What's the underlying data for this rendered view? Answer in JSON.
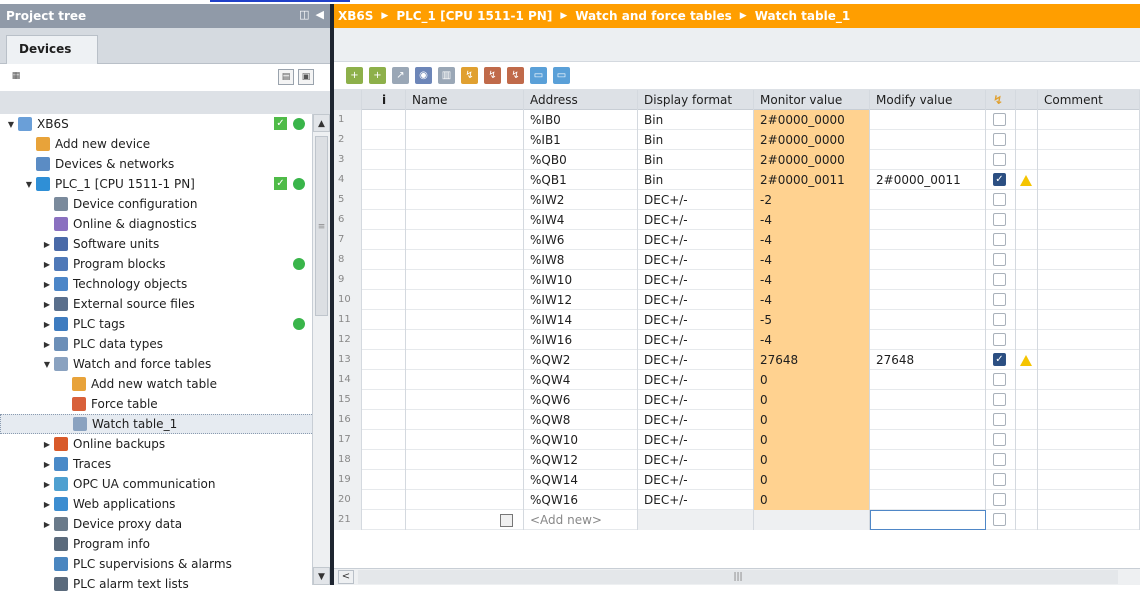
{
  "project_tree": {
    "title": "Project tree",
    "devices_tab": "Devices",
    "items": [
      {
        "label": "XB6S",
        "level": 0,
        "arrow": "▼",
        "icon": "#6a9fd8",
        "status_box": true,
        "status_dot": true
      },
      {
        "label": "Add new device",
        "level": 1,
        "arrow": "",
        "icon": "#e8a33a"
      },
      {
        "label": "Devices & networks",
        "level": 1,
        "arrow": "",
        "icon": "#5b8cc4"
      },
      {
        "label": "PLC_1 [CPU 1511-1 PN]",
        "level": 1,
        "arrow": "▼",
        "icon": "#2f8fd6",
        "status_box": true,
        "status_dot": true
      },
      {
        "label": "Device configuration",
        "level": 2,
        "arrow": "",
        "icon": "#7a8a9c"
      },
      {
        "label": "Online & diagnostics",
        "level": 2,
        "arrow": "",
        "icon": "#8a70c0"
      },
      {
        "label": "Software units",
        "level": 2,
        "arrow": "▶",
        "icon": "#4a6aa8"
      },
      {
        "label": "Program blocks",
        "level": 2,
        "arrow": "▶",
        "icon": "#4f79b8",
        "status_dot": true
      },
      {
        "label": "Technology objects",
        "level": 2,
        "arrow": "▶",
        "icon": "#4c86c8"
      },
      {
        "label": "External source files",
        "level": 2,
        "arrow": "▶",
        "icon": "#5a6f8c"
      },
      {
        "label": "PLC tags",
        "level": 2,
        "arrow": "▶",
        "icon": "#3e7cc0",
        "status_dot": true
      },
      {
        "label": "PLC data types",
        "level": 2,
        "arrow": "▶",
        "icon": "#6c8fb8"
      },
      {
        "label": "Watch and force tables",
        "level": 2,
        "arrow": "▼",
        "icon": "#8aa2c0"
      },
      {
        "label": "Add new watch table",
        "level": 3,
        "arrow": "",
        "icon": "#e8a33a"
      },
      {
        "label": "Force table",
        "level": 3,
        "arrow": "",
        "icon": "#d8603a"
      },
      {
        "label": "Watch table_1",
        "level": 3,
        "arrow": "",
        "icon": "#8aa2c0",
        "selected": true
      },
      {
        "label": "Online backups",
        "level": 2,
        "arrow": "▶",
        "icon": "#d85a2a"
      },
      {
        "label": "Traces",
        "level": 2,
        "arrow": "▶",
        "icon": "#4a8ac8"
      },
      {
        "label": "OPC UA communication",
        "level": 2,
        "arrow": "▶",
        "icon": "#4fa0d0"
      },
      {
        "label": "Web applications",
        "level": 2,
        "arrow": "▶",
        "icon": "#3c8dd0"
      },
      {
        "label": "Device proxy data",
        "level": 2,
        "arrow": "▶",
        "icon": "#6a7a8a"
      },
      {
        "label": "Program info",
        "level": 2,
        "arrow": "",
        "icon": "#5a6a7c"
      },
      {
        "label": "PLC supervisions & alarms",
        "level": 2,
        "arrow": "",
        "icon": "#4a86c0"
      },
      {
        "label": "PLC alarm text lists",
        "level": 2,
        "arrow": "",
        "icon": "#5a6a7c"
      }
    ]
  },
  "breadcrumb": [
    "XB6S",
    "PLC_1 [CPU 1511-1 PN]",
    "Watch and force tables",
    "Watch table_1"
  ],
  "table": {
    "headers": {
      "i": "i",
      "name": "Name",
      "address": "Address",
      "format": "Display format",
      "monitor": "Monitor value",
      "modify": "Modify value",
      "comment": "Comment"
    },
    "rows": [
      {
        "num": "1",
        "address": "%IB0",
        "format": "Bin",
        "monitor": "2#0000_0000",
        "modify": "",
        "checked": false,
        "warn": false
      },
      {
        "num": "2",
        "address": "%IB1",
        "format": "Bin",
        "monitor": "2#0000_0000",
        "modify": "",
        "checked": false,
        "warn": false
      },
      {
        "num": "3",
        "address": "%QB0",
        "format": "Bin",
        "monitor": "2#0000_0000",
        "modify": "",
        "checked": false,
        "warn": false
      },
      {
        "num": "4",
        "address": "%QB1",
        "format": "Bin",
        "monitor": "2#0000_0011",
        "modify": "2#0000_0011",
        "checked": true,
        "warn": true
      },
      {
        "num": "5",
        "address": "%IW2",
        "format": "DEC+/-",
        "monitor": "-2",
        "modify": "",
        "checked": false,
        "warn": false
      },
      {
        "num": "6",
        "address": "%IW4",
        "format": "DEC+/-",
        "monitor": "-4",
        "modify": "",
        "checked": false,
        "warn": false
      },
      {
        "num": "7",
        "address": "%IW6",
        "format": "DEC+/-",
        "monitor": "-4",
        "modify": "",
        "checked": false,
        "warn": false
      },
      {
        "num": "8",
        "address": "%IW8",
        "format": "DEC+/-",
        "monitor": "-4",
        "modify": "",
        "checked": false,
        "warn": false
      },
      {
        "num": "9",
        "address": "%IW10",
        "format": "DEC+/-",
        "monitor": "-4",
        "modify": "",
        "checked": false,
        "warn": false
      },
      {
        "num": "10",
        "address": "%IW12",
        "format": "DEC+/-",
        "monitor": "-4",
        "modify": "",
        "checked": false,
        "warn": false
      },
      {
        "num": "11",
        "address": "%IW14",
        "format": "DEC+/-",
        "monitor": "-5",
        "modify": "",
        "checked": false,
        "warn": false
      },
      {
        "num": "12",
        "address": "%IW16",
        "format": "DEC+/-",
        "monitor": "-4",
        "modify": "",
        "checked": false,
        "warn": false
      },
      {
        "num": "13",
        "address": "%QW2",
        "format": "DEC+/-",
        "monitor": "27648",
        "modify": "27648",
        "checked": true,
        "warn": true
      },
      {
        "num": "14",
        "address": "%QW4",
        "format": "DEC+/-",
        "monitor": "0",
        "modify": "",
        "checked": false,
        "warn": false
      },
      {
        "num": "15",
        "address": "%QW6",
        "format": "DEC+/-",
        "monitor": "0",
        "modify": "",
        "checked": false,
        "warn": false
      },
      {
        "num": "16",
        "address": "%QW8",
        "format": "DEC+/-",
        "monitor": "0",
        "modify": "",
        "checked": false,
        "warn": false
      },
      {
        "num": "17",
        "address": "%QW10",
        "format": "DEC+/-",
        "monitor": "0",
        "modify": "",
        "checked": false,
        "warn": false
      },
      {
        "num": "18",
        "address": "%QW12",
        "format": "DEC+/-",
        "monitor": "0",
        "modify": "",
        "checked": false,
        "warn": false
      },
      {
        "num": "19",
        "address": "%QW14",
        "format": "DEC+/-",
        "monitor": "0",
        "modify": "",
        "checked": false,
        "warn": false
      },
      {
        "num": "20",
        "address": "%QW16",
        "format": "DEC+/-",
        "monitor": "0",
        "modify": "",
        "checked": false,
        "warn": false
      }
    ],
    "add_new": {
      "num": "21",
      "label": "<Add new>"
    }
  },
  "colors": {
    "accent": "#ff9e00",
    "monitor_bg": "#ffd290",
    "tree_header": "#909aa8",
    "status_green": "#39b54a"
  }
}
